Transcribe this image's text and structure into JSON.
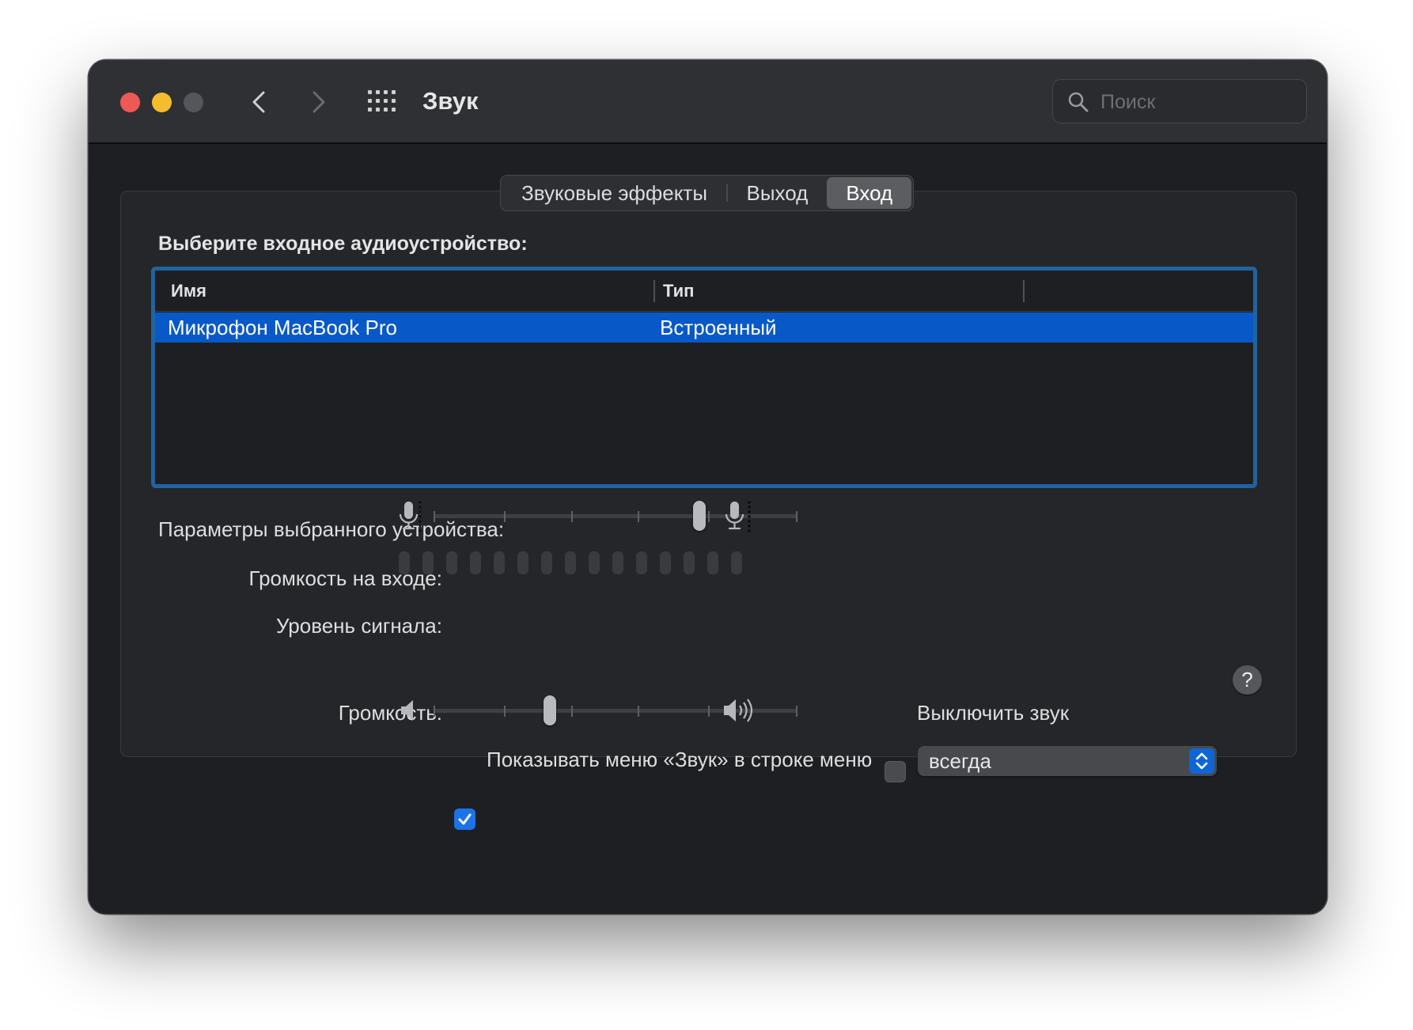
{
  "window": {
    "title": "Звук",
    "search_placeholder": "Поиск"
  },
  "tabs": [
    {
      "label": "Звуковые эффекты",
      "active": false
    },
    {
      "label": "Выход",
      "active": false
    },
    {
      "label": "Вход",
      "active": true
    }
  ],
  "input": {
    "section_title": "Выберите входное аудиоустройство:",
    "columns": [
      "Имя",
      "Тип"
    ],
    "devices": [
      {
        "name": "Микрофон MacBook Pro",
        "type": "Встроенный",
        "selected": true
      }
    ],
    "params_title": "Параметры выбранного устройства:",
    "input_volume_label": "Громкость на входе:",
    "input_volume_value": 0.73,
    "signal_level_label": "Уровень сигнала:",
    "signal_level_segments": 15,
    "signal_level_value": 0
  },
  "output": {
    "volume_label": "Громкость:",
    "volume_value": 0.32,
    "mute_label": "Выключить звук",
    "mute_checked": false,
    "show_menu_label": "Показывать меню «Звук» в строке меню",
    "show_menu_checked": true,
    "show_menu_option": "всегда"
  },
  "colors": {
    "accent": "#0859c7",
    "table_focus_ring": "#20649f",
    "close": "#ed5a55",
    "minimize": "#f6bc2f"
  }
}
